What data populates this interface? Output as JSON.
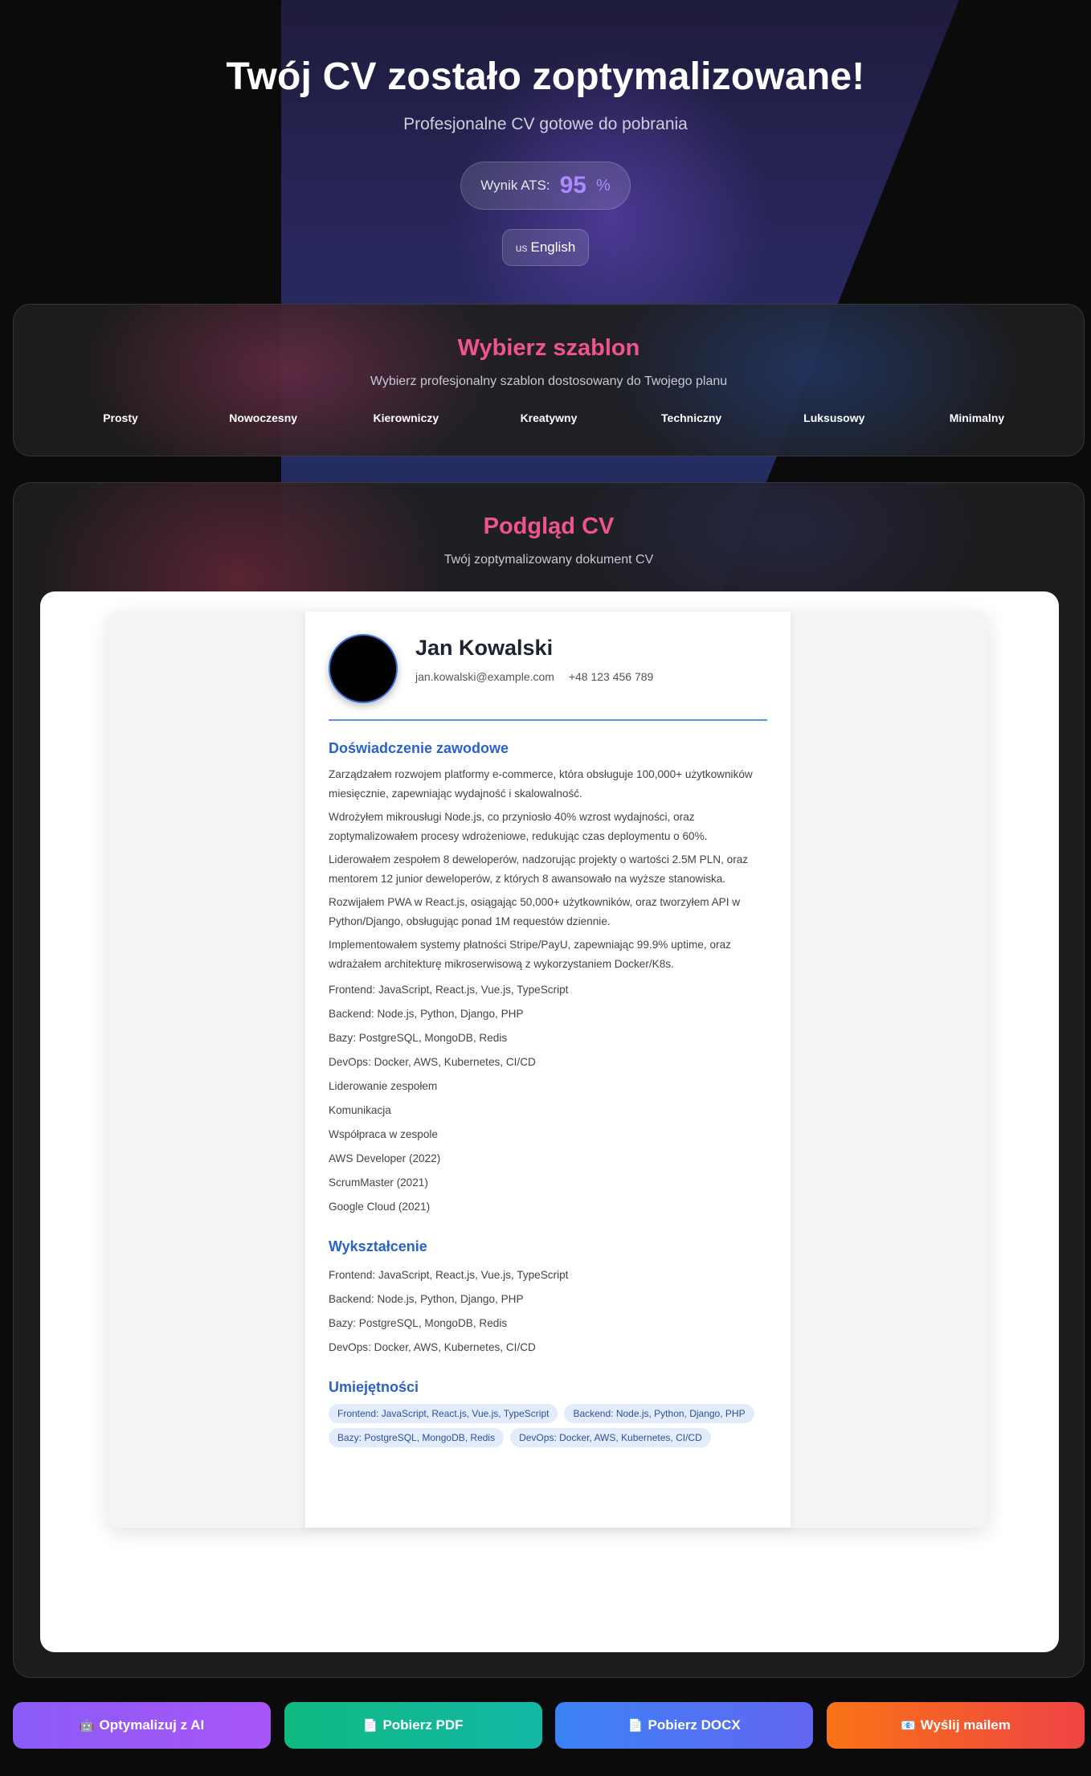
{
  "hero": {
    "title": "Twój CV zostało zoptymalizowane!",
    "subtitle": "Profesjonalne CV gotowe do pobrania",
    "ats_label": "Wynik ATS:",
    "ats_score": "95",
    "ats_unit": "%",
    "language_flag": "us",
    "language": "English"
  },
  "templates": {
    "title": "Wybierz szablon",
    "subtitle": "Wybierz profesjonalny szablon dostosowany do Twojego planu",
    "items": [
      "Prosty",
      "Nowoczesny",
      "Kierowniczy",
      "Kreatywny",
      "Techniczny",
      "Luksusowy",
      "Minimalny"
    ]
  },
  "preview": {
    "title": "Podgląd CV",
    "subtitle": "Twój zoptymalizowany dokument CV"
  },
  "cv": {
    "name": "Jan Kowalski",
    "email": "jan.kowalski@example.com",
    "phone": "+48 123 456 789",
    "experience_heading": "Doświadczenie zawodowe",
    "experience": [
      "Zarządzałem rozwojem platformy e-commerce, która obsługuje 100,000+ użytkowników miesięcznie, zapewniając wydajność i skalowalność.",
      "Wdrożyłem mikrousługi Node.js, co przyniosło 40% wzrost wydajności, oraz zoptymalizowałem procesy wdrożeniowe, redukując czas deploymentu o 60%.",
      "Liderowałem zespołem 8 deweloperów, nadzorując projekty o wartości 2.5M PLN, oraz mentorem 12 junior deweloperów, z których 8 awansowało na wyższe stanowiska.",
      "Rozwijałem PWA w React.js, osiągając 50,000+ użytkowników, oraz tworzyłem API w Python/Django, obsługując ponad 1M requestów dziennie.",
      "Implementowałem systemy płatności Stripe/PayU, zapewniając 99.9% uptime, oraz wdrażałem architekturę mikroserwisową z wykorzystaniem Docker/K8s."
    ],
    "experience_lines": [
      "Frontend: JavaScript, React.js, Vue.js, TypeScript",
      "Backend: Node.js, Python, Django, PHP",
      "Bazy: PostgreSQL, MongoDB, Redis",
      "DevOps: Docker, AWS, Kubernetes, CI/CD",
      "Liderowanie zespołem",
      "Komunikacja",
      "Współpraca w zespole",
      "AWS Developer (2022)",
      "ScrumMaster (2021)",
      "Google Cloud (2021)"
    ],
    "education_heading": "Wykształcenie",
    "education_lines": [
      "Frontend: JavaScript, React.js, Vue.js, TypeScript",
      "Backend: Node.js, Python, Django, PHP",
      "Bazy: PostgreSQL, MongoDB, Redis",
      "DevOps: Docker, AWS, Kubernetes, CI/CD"
    ],
    "skills_heading": "Umiejętności",
    "skills": [
      "Frontend: JavaScript, React.js, Vue.js, TypeScript",
      "Backend: Node.js, Python, Django, PHP",
      "Bazy: PostgreSQL, MongoDB, Redis",
      "DevOps: Docker, AWS, Kubernetes, CI/CD"
    ]
  },
  "actions": {
    "ai_icon": "🤖",
    "ai": "Optymalizuj z AI",
    "pdf_icon": "📄",
    "pdf": "Pobierz PDF",
    "docx_icon": "📄",
    "docx": "Pobierz DOCX",
    "mail_icon": "📧",
    "mail": "Wyślij mailem"
  },
  "colors": {
    "accent_pink": "#f0558a",
    "cv_blue": "#2a62c9",
    "ats_purple": "#a98bff"
  }
}
